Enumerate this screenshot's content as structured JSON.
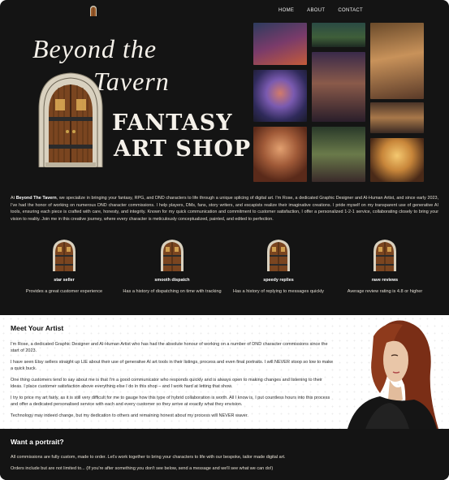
{
  "colors": {
    "background": "#141414",
    "text": "#e8e2d6",
    "light_section": "#ffffff",
    "door_wood": "#9a5a28",
    "door_frame": "#cfc7b4"
  },
  "nav": {
    "logo_icon": "door-icon",
    "links": [
      {
        "label": "HOME"
      },
      {
        "label": "ABOUT"
      },
      {
        "label": "CONTACT"
      }
    ]
  },
  "hero": {
    "brand_line1": "Beyond the",
    "brand_line2": "Tavern",
    "brand_line3": "FANTASY",
    "brand_line4": "ART SHOP",
    "door_icon": "arched-tavern-door-icon",
    "gallery": [
      {
        "name": "gallery-tile-creature"
      },
      {
        "name": "gallery-tile-forest"
      },
      {
        "name": "gallery-tile-beastfolk"
      },
      {
        "name": "gallery-tile-spider"
      },
      {
        "name": "gallery-tile-warrior"
      },
      {
        "name": "gallery-tile-pirate"
      },
      {
        "name": "gallery-tile-sorceress"
      },
      {
        "name": "gallery-tile-dancer"
      },
      {
        "name": "gallery-tile-angel"
      }
    ]
  },
  "intro": {
    "lead": "At ",
    "brand": "Beyond The Tavern",
    "text": ", we specialize in bringing your fantasy, RPG, and DND characters to life through a unique splicing of digital art. I'm Rose, a dedicated Graphic Designer and AI-Human Artist, and since early 2023, I've had the honor of working on numerous DND character commissions. I help players, DMs, fans, story writers, and escapists realize their imaginative creations. I pride myself on my transparent use of generative AI tools, ensuring each piece is crafted with care, honesty, and integrity. Known for my quick communication and commitment to customer satisfaction, I offer a personalized 1-2-1 service, collaborating closely to bring your vision to reality. Join me in this creative journey, where every character is meticulously conceptualized, painted, and edited to perfection."
  },
  "features": [
    {
      "title": "star seller",
      "desc": "Provides a great customer experience",
      "icon": "door-icon"
    },
    {
      "title": "smooth dispatch",
      "desc": "Has a history of dispatching on time with tracking",
      "icon": "door-icon"
    },
    {
      "title": "speedy replies",
      "desc": "Has a history of replying to messages quickly",
      "icon": "door-icon"
    },
    {
      "title": "rave reviews",
      "desc": "Average review rating is 4.8 or higher",
      "icon": "door-icon"
    }
  ],
  "meet": {
    "title": "Meet Your Artist",
    "paragraphs": [
      "I'm Rose, a dedicated Graphic Designer and AI-Human Artist who has had the absolute honour of working on a number of DND character commissions since the start of 2023.",
      "I have seen Etsy sellers straight up LIE about their use of generative AI art tools in their listings, process and even final portraits. I will NEVER stoop so low to make a quick buck.",
      "One thing customers tend to say about me is that I'm a good communicator who responds quickly and is always open to making changes and listening to their ideas. I place customer satisfaction above everything else I do in this shop – and I work hard at letting that show.",
      "I try to price my art fairly, as it is still very difficult for me to gauge how this type of hybrid collaboration is worth. All I know is, I put countless hours into this process and offer a dedicated personalised service with each and every customer so they arrive at exactly what they envision.",
      "Technology may indeed change, but my dedication to others and remaining honest about my process will NEVER waver."
    ],
    "portrait": "artist-portrait"
  },
  "want": {
    "title": "Want a portrait?",
    "line1": "All commissions are fully custom, made to order. Let's work together to bring your characters to life with our bespoke, tailor made digital art.",
    "line2": "Orders include but are not limited to... (If you're after something you don't see below, send a message and we'll see what we can do!)"
  }
}
